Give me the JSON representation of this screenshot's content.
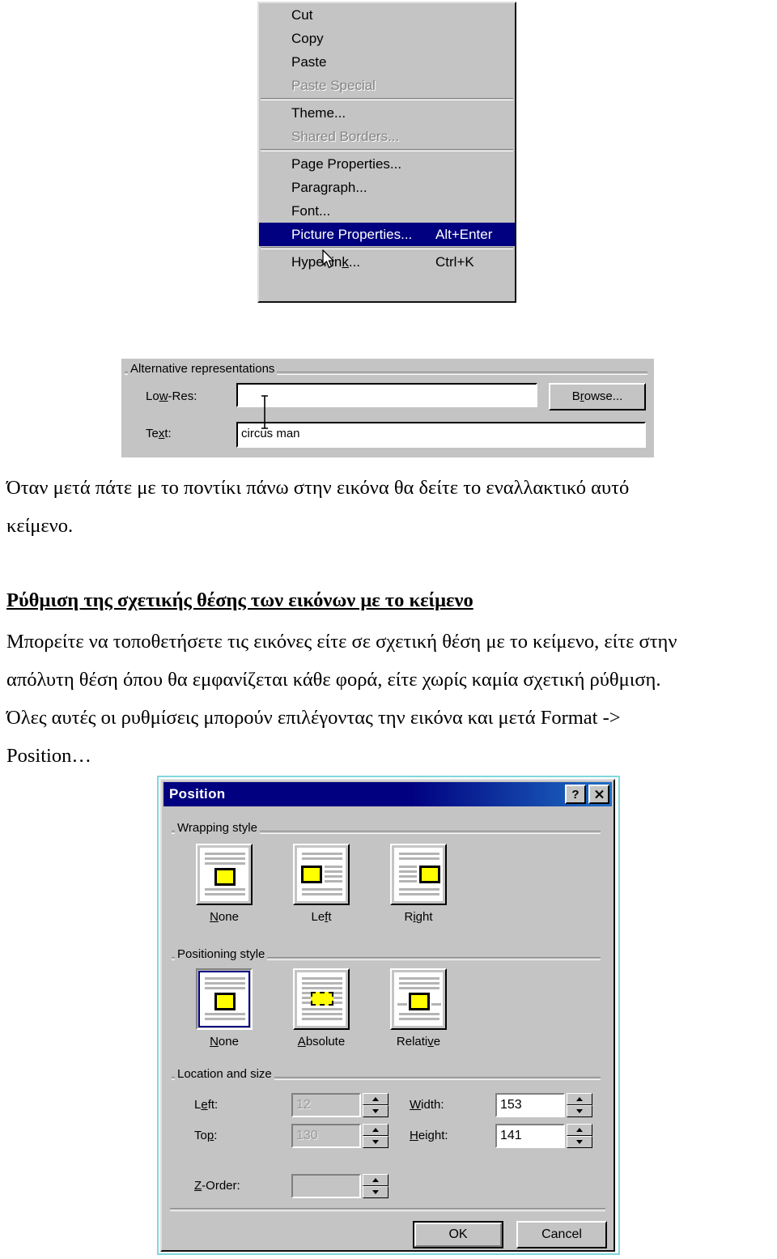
{
  "context_menu": {
    "name": "Shortcut context menu",
    "items": [
      {
        "label": "Cut",
        "accel": "",
        "disabled": false,
        "selected": false
      },
      {
        "label": "Copy",
        "accel": "",
        "disabled": false,
        "selected": false
      },
      {
        "label": "Paste",
        "accel": "",
        "disabled": false,
        "selected": false
      },
      {
        "label": "Paste Special",
        "accel": "",
        "disabled": true,
        "selected": false
      },
      {
        "separator": true
      },
      {
        "label": "Theme...",
        "accel": "",
        "disabled": false,
        "selected": false
      },
      {
        "label": "Shared Borders...",
        "accel": "",
        "disabled": true,
        "selected": false
      },
      {
        "separator": true
      },
      {
        "label": "Page Properties...",
        "accel": "",
        "disabled": false,
        "selected": false
      },
      {
        "label": "Paragraph...",
        "accel": "",
        "disabled": false,
        "selected": false
      },
      {
        "label": "Font...",
        "accel": "",
        "disabled": false,
        "selected": false
      },
      {
        "label": "Picture Properties...",
        "accel": "Alt+Enter",
        "disabled": false,
        "selected": true
      },
      {
        "separator": true
      },
      {
        "label": "Hyperlink...",
        "accel": "Ctrl+K",
        "disabled": false,
        "selected": false
      }
    ],
    "highlight_color": "#000080",
    "face_color": "#c4c4c4"
  },
  "alt_representations": {
    "group_title": "Alternative representations",
    "lowres_label": "Low-Res:",
    "lowres_value": "",
    "browse_button": "Browse...",
    "text_label": "Text:",
    "text_value": "circus man"
  },
  "document_text": {
    "para1": "Όταν μετά πάτε με το ποντίκι πάνω στην εικόνα θα δείτε το εναλλακτικό αυτό",
    "para1_line2": "κείμενο.",
    "heading": "Ρύθμιση της σχετικής θέσης των εικόνων με το κείμενο",
    "para2_line1": "Μπορείτε να τοποθετήσετε τις εικόνες είτε σε σχετική θέση με το κείμενο, είτε στην",
    "para2_line2": "απόλυτη θέση όπου θα εμφανίζεται κάθε φορά, είτε χωρίς καμία σχετική ρύθμιση.",
    "para2_line3": "Όλες αυτές οι ρυθμίσεις μπορούν επιλέγοντας την εικόνα και μετά Format ->",
    "para2_line4": "Position…"
  },
  "position_dialog": {
    "title": "Position",
    "help_button": "?",
    "close_button": "✕",
    "wrapping_style": {
      "group_title": "Wrapping style",
      "options": [
        {
          "label": "None",
          "accel_char": "o",
          "selected": false
        },
        {
          "label": "Left",
          "accel_char": "f",
          "selected": false
        },
        {
          "label": "Right",
          "accel_char": "i",
          "selected": false
        }
      ]
    },
    "positioning_style": {
      "group_title": "Positioning style",
      "options": [
        {
          "label": "None",
          "accel_char": "N",
          "selected": true
        },
        {
          "label": "Absolute",
          "accel_char": "A",
          "selected": false
        },
        {
          "label": "Relative",
          "accel_char": "v",
          "selected": false
        }
      ]
    },
    "location_and_size": {
      "group_title": "Location and size",
      "fields": [
        {
          "label": "Left:",
          "value": "12",
          "disabled": true
        },
        {
          "label": "Top:",
          "value": "130",
          "disabled": true
        },
        {
          "label": "Width:",
          "value": "153",
          "disabled": false
        },
        {
          "label": "Height:",
          "value": "141",
          "disabled": false
        },
        {
          "label": "Z-Order:",
          "value": "",
          "disabled": true
        }
      ]
    },
    "ok_button": "OK",
    "cancel_button": "Cancel",
    "titlebar_color": "#000080",
    "face_color": "#c4c4c4",
    "selection_color": "#000080",
    "image_swatch_color": "#ffff00"
  }
}
